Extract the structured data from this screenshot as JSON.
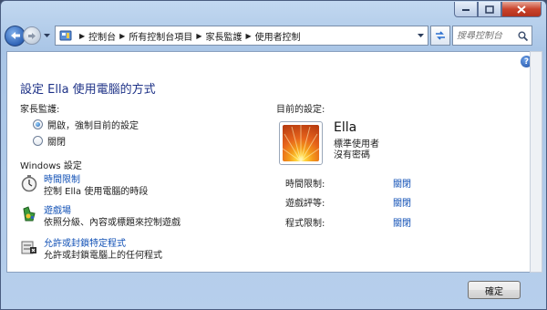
{
  "window": {
    "caption": {
      "minimize": "minimize",
      "maximize": "maximize",
      "close": "close"
    }
  },
  "nav": {
    "back_icon": "back-arrow-icon",
    "forward_icon": "forward-arrow-icon",
    "breadcrumbs": [
      "控制台",
      "所有控制台項目",
      "家長監護",
      "使用者控制"
    ],
    "search_placeholder": "搜尋控制台"
  },
  "main": {
    "title": "設定 Ella 使用電腦的方式",
    "parental_controls": {
      "heading": "家長監護:",
      "options": [
        {
          "label": "開啟，強制目前的設定",
          "selected": true
        },
        {
          "label": "關閉",
          "selected": false
        }
      ]
    },
    "windows_settings": {
      "heading": "Windows 設定",
      "items": [
        {
          "icon": "stopwatch-icon",
          "link": "時間限制",
          "desc": "控制 Ella 使用電腦的時段"
        },
        {
          "icon": "game-controller-icon",
          "link": "遊戲場",
          "desc": "依照分級、內容或標題來控制遊戲"
        },
        {
          "icon": "program-blocker-icon",
          "link": "允許或封鎖特定程式",
          "desc": "允許或封鎖電腦上的任何程式"
        }
      ]
    },
    "current_settings": {
      "heading": "目前的設定:",
      "user": {
        "name": "Ella",
        "account_type": "標準使用者",
        "password": "沒有密碼"
      },
      "rows": [
        {
          "label": "時間限制:",
          "value": "關閉"
        },
        {
          "label": "遊戲評等:",
          "value": "關閉"
        },
        {
          "label": "程式限制:",
          "value": "關閉"
        }
      ]
    }
  },
  "footer": {
    "ok_label": "確定"
  },
  "colors": {
    "link": "#0f4fb5",
    "title": "#1e3287",
    "close_button": "#c9432c"
  }
}
